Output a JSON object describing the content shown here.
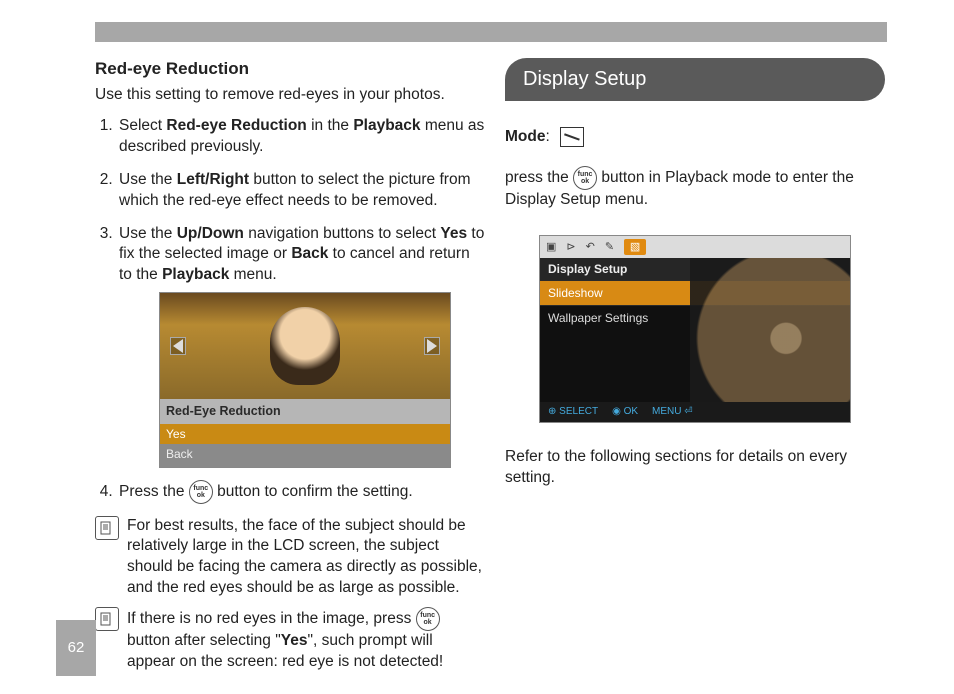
{
  "page_number": "62",
  "left": {
    "heading": "Red-eye Reduction",
    "intro": "Use this setting to remove red-eyes in your photos.",
    "step1_a": "Select ",
    "step1_b": "Red-eye Reduction",
    "step1_c": " in the ",
    "step1_d": "Playback",
    "step1_e": " menu as described previously.",
    "step2_a": "Use the ",
    "step2_b": "Left/Right",
    "step2_c": " button to select the picture from which the red-eye effect needs to be removed.",
    "step3_a": "Use the ",
    "step3_b": "Up/Down",
    "step3_c": " navigation buttons to select ",
    "step3_d": "Yes",
    "step3_e": " to fix the selected image or ",
    "step3_f": "Back",
    "step3_g": " to cancel and return to the ",
    "step3_h": "Playback",
    "step3_i": " menu.",
    "step4_a": "Press the ",
    "step4_b": " button to confirm the setting.",
    "figure1": {
      "title": "Red-Eye Reduction",
      "opt_yes": "Yes",
      "opt_back": "Back"
    },
    "note1": "For best results, the face of the subject should be relatively large in the LCD screen, the subject should be facing the camera as directly as possible, and the red eyes should be as large as possible.",
    "note2_a": "If there is no red eyes in the image, press ",
    "note2_b": " button after selecting \"",
    "note2_c": "Yes",
    "note2_d": "\", such prompt will appear on the screen: red eye is not detected!"
  },
  "right": {
    "pill": "Display Setup",
    "mode_label": "Mode",
    "body_a": "press the ",
    "body_b": " button in Playback mode to enter the Display Setup menu.",
    "figure2": {
      "title": "Display Setup",
      "row1": "Slideshow",
      "row2": "Wallpaper  Settings",
      "foot_select": "SELECT",
      "foot_ok": "OK",
      "foot_menu": "MENU"
    },
    "refer": "Refer to the following sections for details on every setting."
  },
  "icons": {
    "func_top": "func",
    "func_bot": "ok"
  }
}
